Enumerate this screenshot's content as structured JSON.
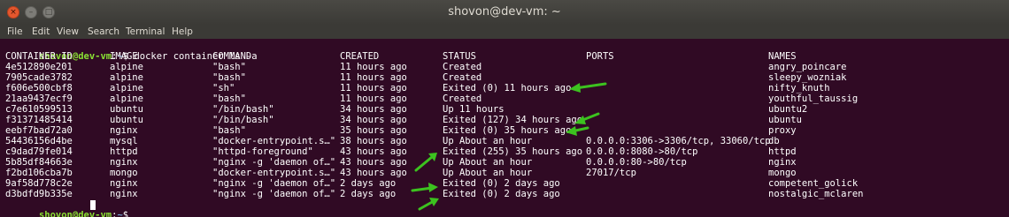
{
  "window": {
    "title": "shovon@dev-vm: ~",
    "close_glyph": "×",
    "minimize_glyph": "–",
    "maximize_glyph": "□"
  },
  "menu": [
    "File",
    "Edit",
    "View",
    "Search",
    "Terminal",
    "Help"
  ],
  "prompt": {
    "user": "shovon@dev-vm",
    "sep": ":",
    "path": "~",
    "symbol": "$ "
  },
  "command": "docker container ls -a",
  "columns": [
    "CONTAINER ID",
    "IMAGE",
    "COMMAND",
    "CREATED",
    "STATUS",
    "PORTS",
    "NAMES"
  ],
  "rows": [
    [
      "4e512890e201",
      "alpine",
      "\"bash\"",
      "11 hours ago",
      "Created",
      "",
      "angry_poincare"
    ],
    [
      "7905cade3782",
      "alpine",
      "\"bash\"",
      "11 hours ago",
      "Created",
      "",
      "sleepy_wozniak"
    ],
    [
      "f606e500cbf8",
      "alpine",
      "\"sh\"",
      "11 hours ago",
      "Exited (0) 11 hours ago",
      "",
      "nifty_knuth"
    ],
    [
      "21aa9437ecf9",
      "alpine",
      "\"bash\"",
      "11 hours ago",
      "Created",
      "",
      "youthful_taussig"
    ],
    [
      "c7e610599513",
      "ubuntu",
      "\"/bin/bash\"",
      "34 hours ago",
      "Up 11 hours",
      "",
      "ubuntu2"
    ],
    [
      "f31371485414",
      "ubuntu",
      "\"/bin/bash\"",
      "34 hours ago",
      "Exited (127) 34 hours ago",
      "",
      "ubuntu"
    ],
    [
      "eebf7bad72a0",
      "nginx",
      "\"bash\"",
      "35 hours ago",
      "Exited (0) 35 hours ago",
      "",
      "proxy"
    ],
    [
      "54436156d4be",
      "mysql",
      "\"docker-entrypoint.s…\"",
      "38 hours ago",
      "Up About an hour",
      "0.0.0.0:3306->3306/tcp, 33060/tcp",
      "db"
    ],
    [
      "c9dad79fe014",
      "httpd",
      "\"httpd-foreground\"",
      "43 hours ago",
      "Exited (255) 35 hours ago",
      "0.0.0.0:8080->80/tcp",
      "httpd"
    ],
    [
      "5b85df84663e",
      "nginx",
      "\"nginx -g 'daemon of…\"",
      "43 hours ago",
      "Up About an hour",
      "0.0.0.0:80->80/tcp",
      "nginx"
    ],
    [
      "f2bd106cba7b",
      "mongo",
      "\"docker-entrypoint.s…\"",
      "43 hours ago",
      "Up About an hour",
      "27017/tcp",
      "mongo"
    ],
    [
      "9af58d778c2e",
      "nginx",
      "\"nginx -g 'daemon of…\"",
      "2 days ago",
      "Exited (0) 2 days ago",
      "",
      "competent_golick"
    ],
    [
      "d3bdfd9b335e",
      "nginx",
      "\"nginx -g 'daemon of…\"",
      "2 days ago",
      "Exited (0) 2 days ago",
      "",
      "nostalgic_mclaren"
    ]
  ],
  "colors": {
    "terminal_bg": "#300a24",
    "prompt_user": "#8ae234",
    "prompt_path": "#729fcf",
    "annotation_arrow": "#3cc21f"
  },
  "annotation_icon": "green-arrow-icon"
}
